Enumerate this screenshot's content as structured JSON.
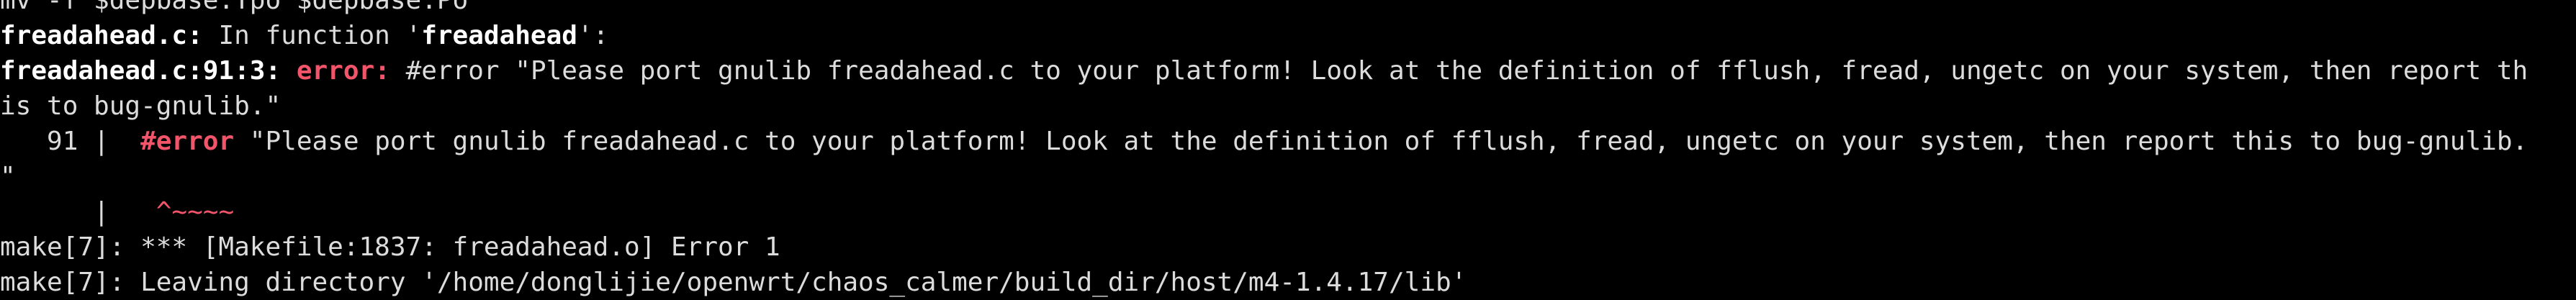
{
  "colors": {
    "background": "#000000",
    "text": "#dcdcdc",
    "bold_text": "#ffffff",
    "error": "#f2556a"
  },
  "lines": {
    "cmd_partial": "mv -f $depbase.Tpo $depbase.Po",
    "in_function": {
      "file": "freadahead.c:",
      "text": " In function '",
      "func": "freadahead",
      "end": "':"
    },
    "error_line": {
      "loc": "freadahead.c:91:3:",
      "label": "error:",
      "message": "#error \"Please port gnulib freadahead.c to your platform! Look at the definition of fflush, fread, ungetc on your system, then report th"
    },
    "error_wrap": "is to bug-gnulib.\"",
    "source_line": {
      "prefix": "   91 |  ",
      "directive": "#error",
      "rest": " \"Please port gnulib freadahead.c to your platform! Look at the definition of fflush, fread, ungetc on your system, then report this to bug-gnulib."
    },
    "source_wrap": "\"",
    "caret_line": {
      "prefix": "      |   ",
      "marker": "^~~~~"
    },
    "make_error": "make[7]: *** [Makefile:1837: freadahead.o] Error 1",
    "make_leave": "make[7]: Leaving directory '/home/donglijie/openwrt/chaos_calmer/build_dir/host/m4-1.4.17/lib'"
  }
}
